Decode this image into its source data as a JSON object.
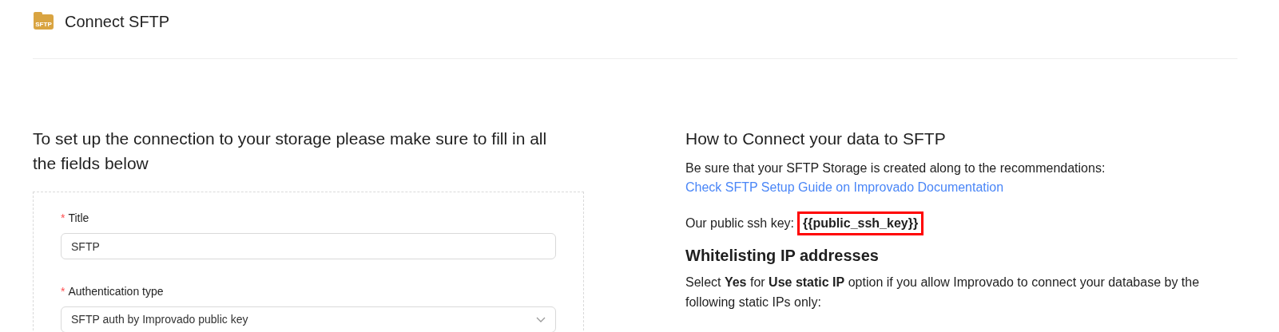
{
  "header": {
    "title": "Connect SFTP",
    "icon_label": "SFTP"
  },
  "form": {
    "heading": "To set up the connection to your storage please make sure to fill in all the fields below",
    "fields": [
      {
        "kind": "input",
        "label": "Title",
        "required_mark": "*",
        "value": "SFTP"
      },
      {
        "kind": "select",
        "label": "Authentication type",
        "required_mark": "*",
        "value": "SFTP auth by Improvado public key"
      }
    ]
  },
  "help": {
    "heading": "How to Connect your data to SFTP",
    "intro": "Be sure that your SFTP Storage is created along to the recommendations:",
    "link": "Check SFTP Setup Guide on Improvado Documentation",
    "key_label": "Our public ssh key:",
    "key_value": "{{public_ssh_key}}",
    "key_highlighted": true,
    "subheading": "Whitelisting IP addresses",
    "whitelist_text": "Select **Yes** for **Use static IP** option if you allow Improvado to connect your database by the following static IPs only:"
  }
}
